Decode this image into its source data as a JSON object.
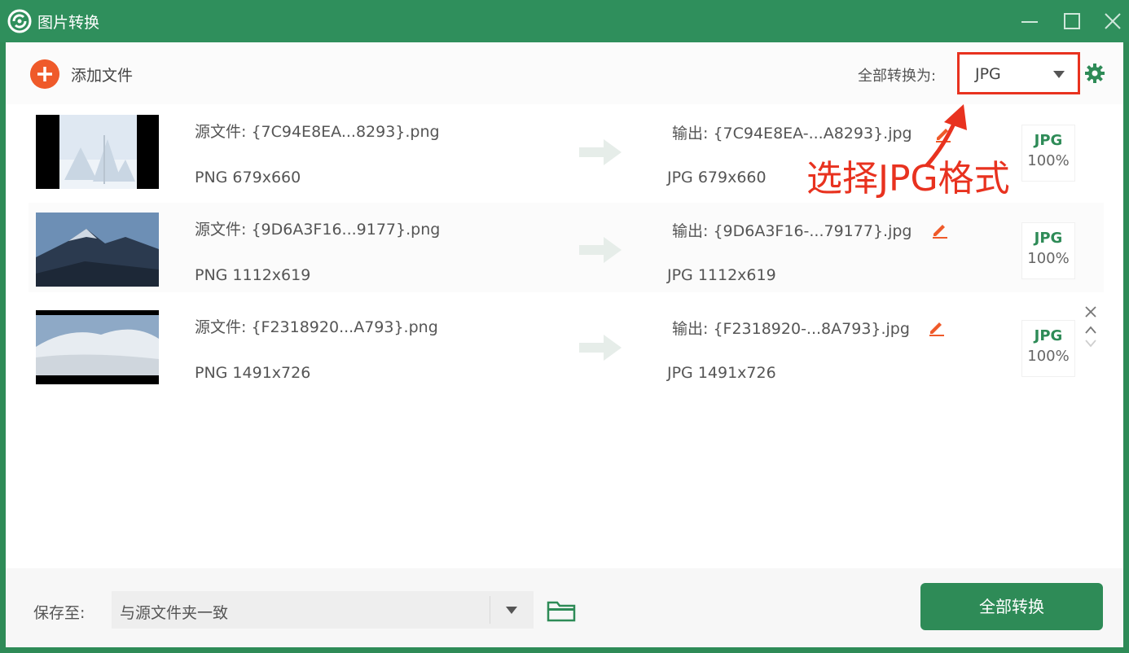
{
  "window": {
    "title": "图片转换"
  },
  "toolbar": {
    "add_label": "添加文件",
    "convert_to_label": "全部转换为:",
    "format_value": "JPG"
  },
  "files": [
    {
      "source": "源文件: {7C94E8EA...8293}.png",
      "source_meta": "PNG  679x660",
      "output": "输出: {7C94E8EA-...A8293}.jpg",
      "output_meta": "JPG  679x660",
      "format": "JPG",
      "quality": "100%"
    },
    {
      "source": "源文件: {9D6A3F16...9177}.png",
      "source_meta": "PNG  1112x619",
      "output": "输出: {9D6A3F16-...79177}.jpg",
      "output_meta": "JPG  1112x619",
      "format": "JPG",
      "quality": "100%"
    },
    {
      "source": "源文件: {F2318920...A793}.png",
      "source_meta": "PNG  1491x726",
      "output": "输出: {F2318920-...8A793}.jpg",
      "output_meta": "JPG  1491x726",
      "format": "JPG",
      "quality": "100%"
    }
  ],
  "annotation": "选择JPG格式",
  "footer": {
    "save_label": "保存至:",
    "save_value": "与源文件夹一致",
    "convert_all_label": "全部转换"
  },
  "colors": {
    "brand": "#2e8b57",
    "accent": "#ef5a2a",
    "highlight": "#e8321f"
  }
}
